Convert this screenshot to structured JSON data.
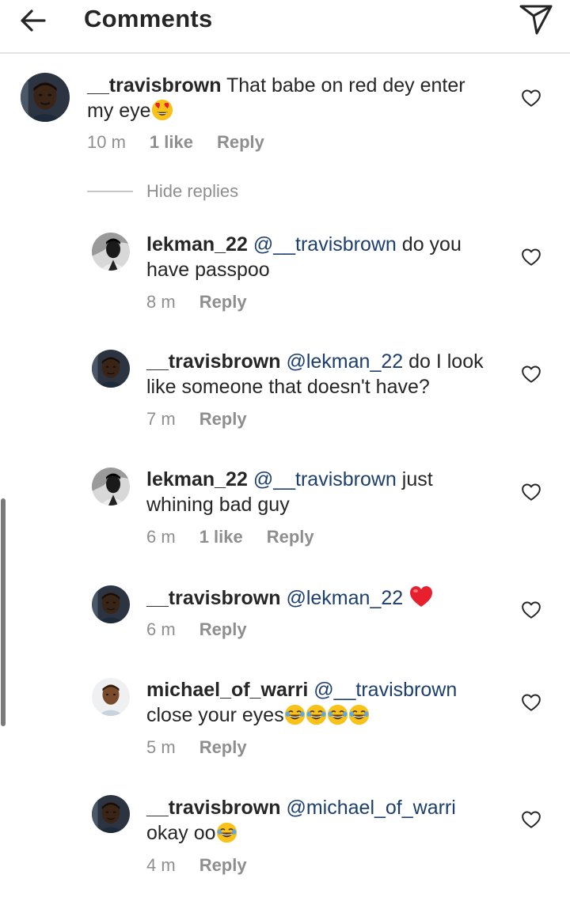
{
  "header": {
    "title": "Comments"
  },
  "comment": {
    "username": "__travisbrown",
    "text": " That babe on red dey enter",
    "text_cont": "my eye",
    "time": "10 m",
    "likes": "1 like",
    "reply": "Reply"
  },
  "hide_replies": "Hide replies",
  "replies": [
    {
      "username": "lekman_22",
      "mention": "@__travisbrown",
      "text": " do you",
      "text_cont": "have passpoo",
      "time": "8 m",
      "reply": "Reply"
    },
    {
      "username": "__travisbrown",
      "mention": "@lekman_22",
      "text": " do I look",
      "text_cont": "like someone that doesn't have?",
      "time": "7 m",
      "reply": "Reply"
    },
    {
      "username": "lekman_22",
      "mention": "@__travisbrown",
      "text": " just",
      "text_cont": "whining bad guy",
      "time": "6 m",
      "likes": "1 like",
      "reply": "Reply"
    },
    {
      "username": "__travisbrown",
      "mention": "@lekman_22",
      "text": " ",
      "time": "6 m",
      "reply": "Reply"
    },
    {
      "username": "michael_of_warri",
      "mention": "@__travisbrown",
      "text_cont": "close your eyes",
      "time": "5 m",
      "reply": "Reply"
    },
    {
      "username": "__travisbrown",
      "mention": "@michael_of_warri",
      "text_cont": "okay oo",
      "time": "4 m",
      "reply": "Reply"
    }
  ],
  "icons": {
    "back": "arrow-left-icon",
    "send": "direct-send-icon",
    "like": "heart-outline-icon",
    "heart_eyes": "heart-eyes-emoji",
    "red_heart": "red-heart-emoji",
    "laugh": "tears-of-joy-emoji"
  },
  "colors": {
    "mention": "#1c3f6e",
    "meta": "#8e8e8e",
    "text": "#262626"
  }
}
